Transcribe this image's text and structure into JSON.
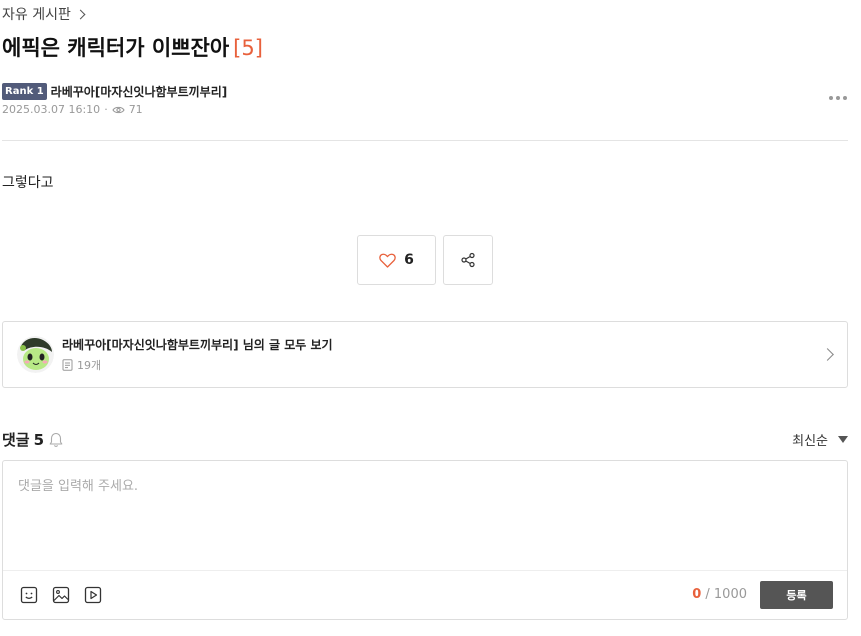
{
  "breadcrumb": {
    "label": "자유 게시판"
  },
  "post": {
    "title": "에픽은 캐릭터가 이쁘잔아",
    "comment_count_bracket": "[5]",
    "rank_badge": "Rank 1",
    "author": "라베꾸아[마자신잇나함부트끼부리]",
    "date": "2025.03.07 16:10",
    "separator": "·",
    "views": "71",
    "body": "그렇다고"
  },
  "actions": {
    "like_count": "6"
  },
  "author_card": {
    "title": "라베꾸아[마자신잇나함부트끼부리] 님의 글 모두 보기",
    "post_count": "19개"
  },
  "comments": {
    "label": "댓글",
    "count": "5",
    "sort_label": "최신순",
    "placeholder": "댓글을 입력해 주세요.",
    "char_current": "0",
    "char_max": "/ 1000",
    "submit_label": "등록"
  },
  "colors": {
    "accent": "#e8613c",
    "rank_badge_bg": "#525b7a",
    "submit_bg": "#555555"
  },
  "icons": [
    "chevron-right-icon",
    "eye-icon",
    "more-icon",
    "heart-icon",
    "share-icon",
    "document-icon",
    "bell-icon",
    "sort-caret-icon",
    "emoji-icon",
    "image-icon",
    "video-icon"
  ]
}
